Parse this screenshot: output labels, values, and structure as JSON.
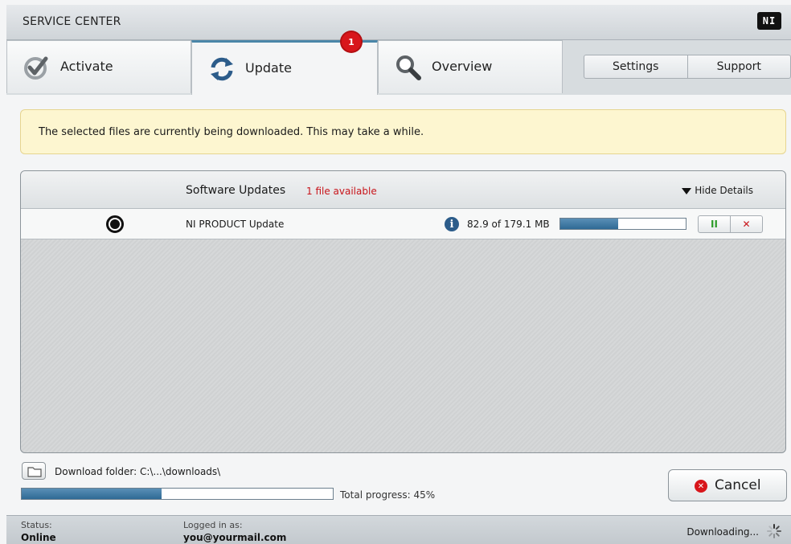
{
  "app": {
    "title": "SERVICE CENTER",
    "logo": "NI"
  },
  "tabs": [
    {
      "label": "Activate",
      "icon": "check-icon"
    },
    {
      "label": "Update",
      "icon": "refresh-icon",
      "badge": "1"
    },
    {
      "label": "Overview",
      "icon": "magnifier-icon"
    }
  ],
  "utility": {
    "settings": "Settings",
    "support": "Support"
  },
  "banner": {
    "text": "The selected files are currently being downloaded. This may take a while."
  },
  "updates": {
    "title": "Software Updates",
    "count": "1 file available",
    "details_toggle": "Hide Details",
    "items": [
      {
        "name": "NI PRODUCT Update",
        "size": "82.9 of 179.1 MB",
        "progress": 0.46
      }
    ]
  },
  "download": {
    "folder_label": "Download folder: C:\\...\\downloads\\",
    "total_label": "Total progress: 45%",
    "total_progress": 0.45
  },
  "cancel": {
    "label": "Cancel"
  },
  "status": {
    "status_label": "Status:",
    "status_value": "Online",
    "user_label": "Logged in as:",
    "user_value": "you@yourmail.com",
    "activity": "Downloading..."
  },
  "colors": {
    "accent": "#4a86a8",
    "alert": "#d8161b",
    "progress": "#2f6a95",
    "banner_bg": "#fdf6d0"
  }
}
